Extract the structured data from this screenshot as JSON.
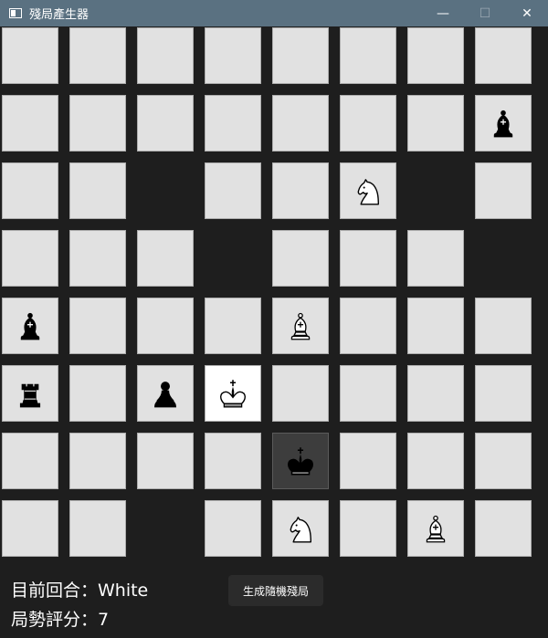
{
  "window": {
    "title": "殘局產生器",
    "minimize_glyph": "—",
    "maximize_glyph": "☐",
    "close_glyph": "✕"
  },
  "board": {
    "rows": [
      [
        "",
        "",
        "",
        "",
        "",
        "",
        "",
        ""
      ],
      [
        "",
        "",
        "",
        "",
        "",
        "",
        "",
        "black-bishop"
      ],
      [
        "",
        "",
        null,
        "",
        "",
        "white-knight",
        null,
        ""
      ],
      [
        "",
        "",
        "",
        null,
        "",
        "",
        "",
        null
      ],
      [
        "black-bishop",
        "",
        "",
        "",
        "white-bishop",
        "",
        "",
        ""
      ],
      [
        "black-rook",
        "",
        "black-pawn",
        "white-king",
        "",
        "",
        "",
        ""
      ],
      [
        "",
        "",
        "",
        "",
        "black-king",
        "",
        "",
        ""
      ],
      [
        "",
        "",
        null,
        "",
        "white-knight",
        "",
        "white-bishop",
        ""
      ]
    ],
    "highlighted": [
      {
        "row": 5,
        "col": 3,
        "style": "white"
      },
      {
        "row": 6,
        "col": 4,
        "style": "dark"
      }
    ]
  },
  "status": {
    "turn_text": "目前回合：White",
    "score_text": "局勢評分：7"
  },
  "generate_button": {
    "label": "生成隨機殘局"
  }
}
